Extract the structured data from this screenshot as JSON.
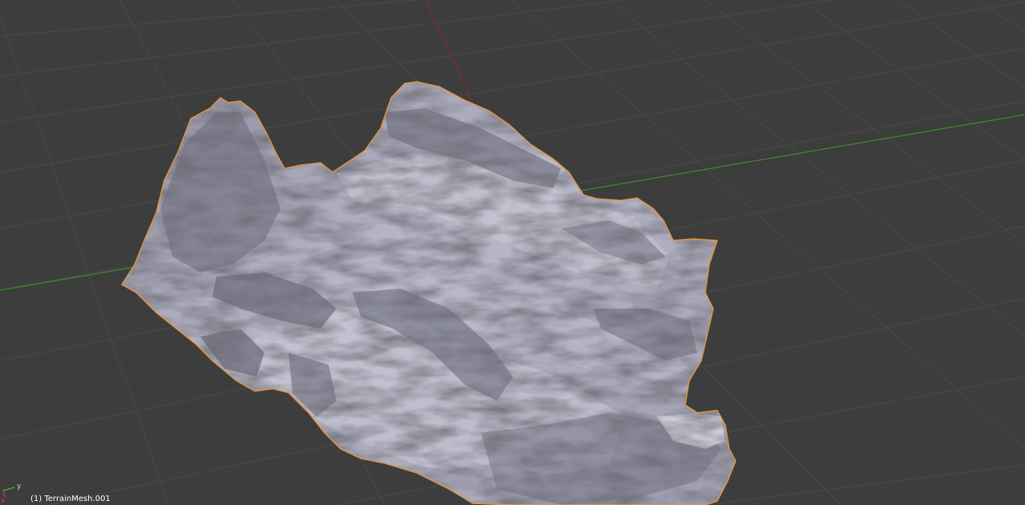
{
  "viewport": {
    "background_color": "#3d3d3d",
    "grid_color": "#4a4a4a",
    "x_axis_color": "#8a2a2a",
    "y_axis_color": "#3f8a2f",
    "selection_outline_color": "#e8953a",
    "mesh_color": "#a6a6b8"
  },
  "status": {
    "object_label": "(1) TerrainMesh.001"
  },
  "axis_gizmo": {
    "y_label": "y",
    "x_label": "x"
  }
}
